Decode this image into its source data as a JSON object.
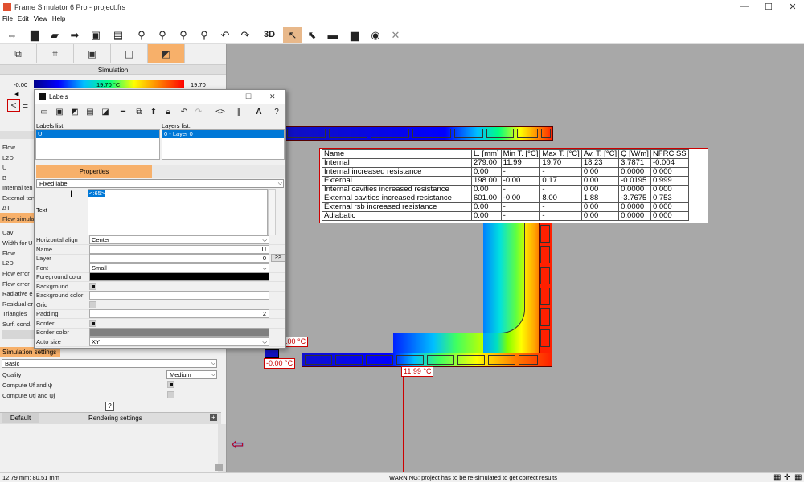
{
  "window": {
    "title": "Frame Simulator 6 Pro - project.frs",
    "minimize": "—",
    "maximize": "☐",
    "close": "✕"
  },
  "menu": [
    "File",
    "Edit",
    "View",
    "Help"
  ],
  "toolbar": {
    "zoom_label": "3D",
    "icons": [
      "swap-horizontal-icon",
      "new-file-icon",
      "open-folder-icon",
      "import-icon",
      "save-icon",
      "print-icon",
      "zoom-in-icon",
      "zoom-out-icon",
      "zoom-fit-icon",
      "zoom-reset-icon",
      "undo-icon",
      "redo-icon",
      "3d-view-icon",
      "select-pointer-icon",
      "select-region-icon",
      "ruler-icon",
      "comment-icon",
      "eye-icon",
      "hide-icon"
    ]
  },
  "left": {
    "simulation_header": "Simulation",
    "scale_min": "-0.00",
    "scale_mid": "19.70 °C",
    "scale_max": "19.70",
    "results": [
      "Flow",
      "L2D",
      "U",
      "B",
      "Internal ten",
      "External ten",
      "ΔT",
      "Flow simula",
      "Uav",
      "Width for U",
      "Flow",
      "L2D",
      "Flow error",
      "Flow error",
      "Radiative e",
      "Residual er",
      "Triangles",
      "Surf. cond."
    ],
    "sim_settings_header": "Simulation settings",
    "preset": "Basic",
    "quality_label": "Quality",
    "quality_value": "Medium",
    "compute_uf": "Compute Uf and ψ",
    "compute_utj": "Compute Utj and ψj",
    "help": "?",
    "default_btn": "Default",
    "rendering": "Rendering settings",
    "plus": "+"
  },
  "status": {
    "coords": "12.79 mm; 80.51 mm",
    "warning": "WARNING: project has to be re-simulated to get correct results"
  },
  "dialog": {
    "title": "Labels",
    "maximize": "☐",
    "close": "✕",
    "labels_list_title": "Labels list:",
    "labels": [
      "U"
    ],
    "layers_list_title": "Layers list:",
    "layers": [
      "0 - Layer 0"
    ],
    "properties_tab": "Properties",
    "label_type": "Fixed label",
    "text_label": "Text",
    "text_value": "<:65>",
    "rows": [
      {
        "label": "Horizontal align",
        "value": "Center"
      },
      {
        "label": "Name",
        "value": "U"
      },
      {
        "label": "Layer",
        "value": "0"
      },
      {
        "label": "Font",
        "value": "Small"
      },
      {
        "label": "Foreground color",
        "value": ""
      },
      {
        "label": "Background",
        "value": ""
      },
      {
        "label": "Background color",
        "value": ""
      },
      {
        "label": "Grid",
        "value": ""
      },
      {
        "label": "Padding",
        "value": "2"
      },
      {
        "label": "Border",
        "value": ""
      },
      {
        "label": "Border color",
        "value": ""
      },
      {
        "label": "Auto size",
        "value": "XY"
      }
    ],
    "layer_btn": ">>"
  },
  "table": {
    "headers": [
      "Name",
      "L. [mm]",
      "Min T. [°C]",
      "Max T. [°C]",
      "Av. T. [°C]",
      "Q [W/m]",
      "NFRC SS"
    ],
    "rows": [
      [
        "Internal",
        "279.00",
        "11.99",
        "19.70",
        "18.23",
        "3.7871",
        "-0.004"
      ],
      [
        "Internal increased resistance",
        "0.00",
        "-",
        "-",
        "0.00",
        "0.0000",
        "0.000"
      ],
      [
        "External",
        "198.00",
        "-0.00",
        "0.17",
        "0.00",
        "-0.0195",
        "0.999"
      ],
      [
        "Internal cavities increased resistance",
        "0.00",
        "-",
        "-",
        "0.00",
        "0.0000",
        "0.000"
      ],
      [
        "External cavities increased resistance",
        "601.00",
        "-0.00",
        "8.00",
        "1.88",
        "-3.7675",
        "0.753"
      ],
      [
        "External rsb increased resistance",
        "0.00",
        "-",
        "-",
        "0.00",
        "0.0000",
        "0.000"
      ],
      [
        "Adiabatic",
        "0.00",
        "-",
        "-",
        "0.00",
        "0.0000",
        "0.000"
      ]
    ]
  },
  "canvas_labels": {
    "temp_a": "-0.00 °C",
    "temp_b": ".00 °C",
    "temp_c": "11.99 °C"
  }
}
